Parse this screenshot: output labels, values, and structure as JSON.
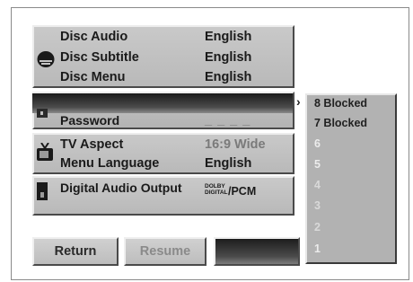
{
  "menu": {
    "audio_section": {
      "disc_audio_label": "Disc Audio",
      "disc_audio_value": "English",
      "disc_subtitle_label": "Disc Subtitle",
      "disc_subtitle_value": "English",
      "disc_menu_label": "Disc Menu",
      "disc_menu_value": "English"
    },
    "lock_section": {
      "rating_label": "",
      "password_label": "Password",
      "password_value": "_ _ _ _"
    },
    "display_section": {
      "tv_aspect_label": "TV Aspect",
      "tv_aspect_value": "16:9 Wide",
      "menu_language_label": "Menu Language",
      "menu_language_value": "English"
    },
    "audio_output_section": {
      "digital_audio_output_label": "Digital Audio Output",
      "dolby_top": "DOLBY",
      "dolby_bottom": "DIGITAL",
      "pcm_value": "/PCM"
    }
  },
  "rating_options": [
    {
      "label": "8 Blocked"
    },
    {
      "label": "7 Blocked"
    },
    {
      "label": "6"
    },
    {
      "label": "5"
    },
    {
      "label": "4"
    },
    {
      "label": "3"
    },
    {
      "label": "2"
    },
    {
      "label": "1"
    }
  ],
  "buttons": {
    "return_label": "Return",
    "resume_label": "Resume",
    "blank_label": ""
  },
  "icons": {
    "subtitle": "subtitle-icon",
    "lock": "lock-icon",
    "tv": "tv-icon",
    "audio_output": "speaker-icon",
    "selection_arrow": "chevron-right-icon"
  }
}
